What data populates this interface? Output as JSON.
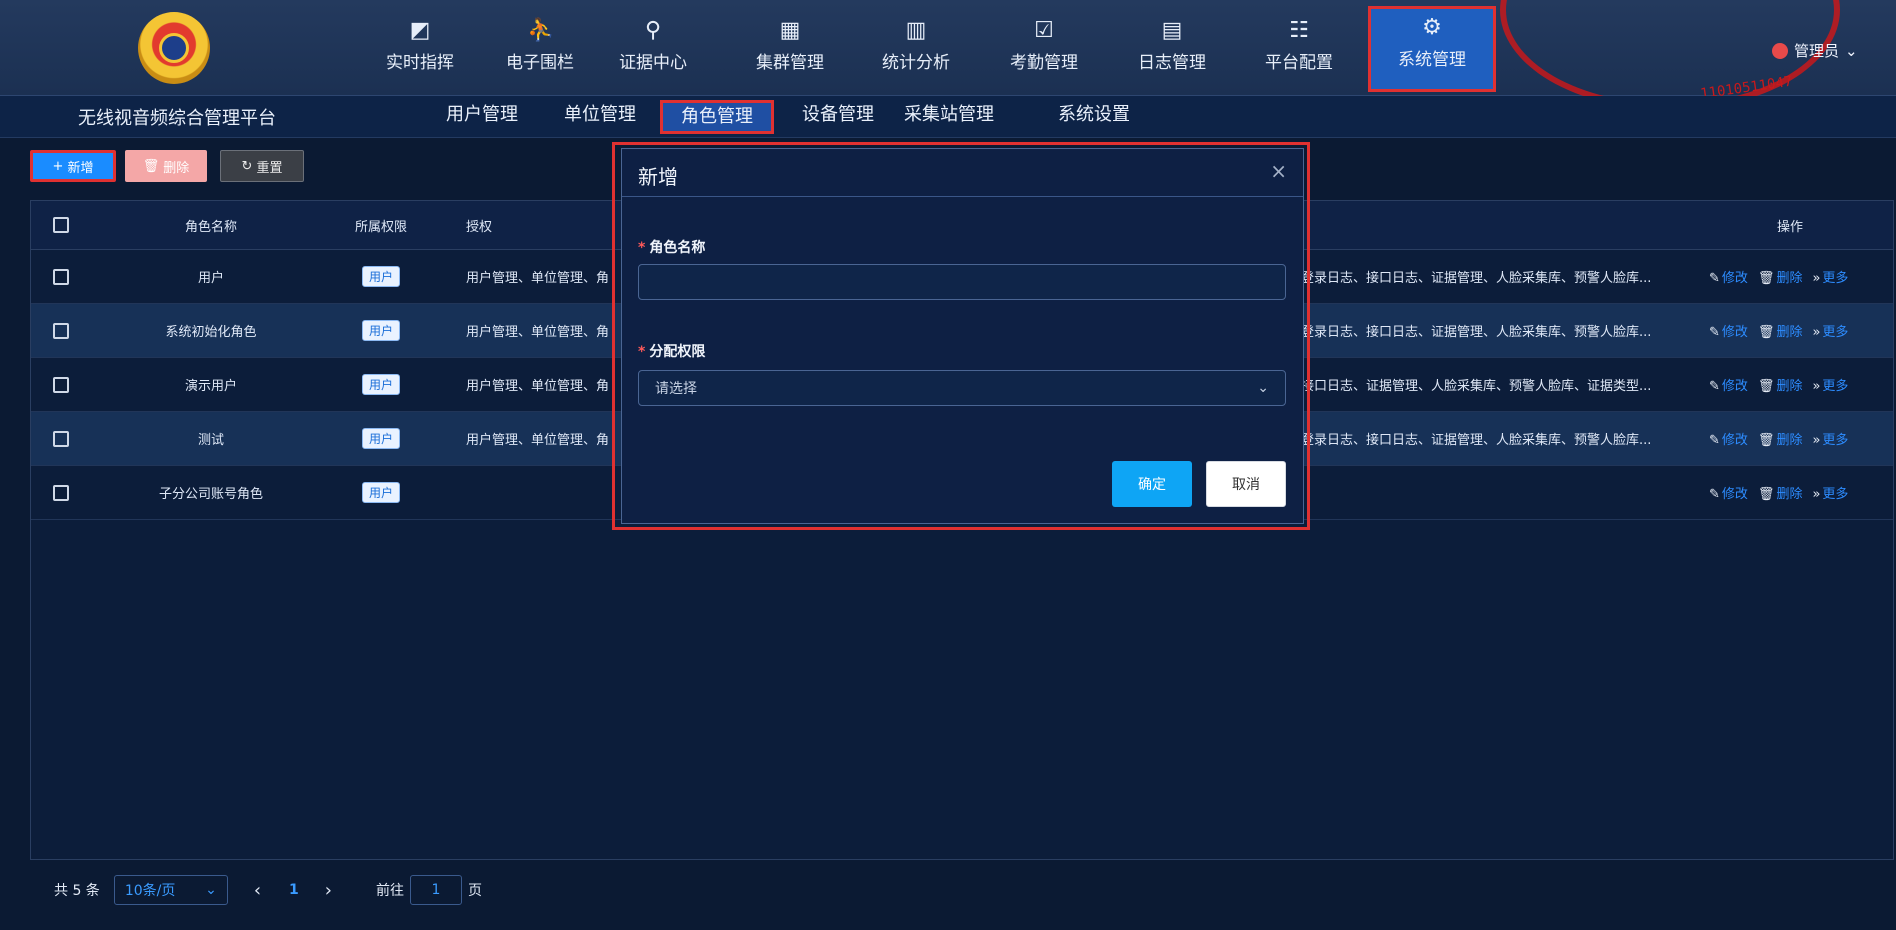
{
  "header": {
    "nav": [
      {
        "label": "实时指挥",
        "icon": "chart-monitor-icon"
      },
      {
        "label": "电子围栏",
        "icon": "fence-runner-icon"
      },
      {
        "label": "证据中心",
        "icon": "evidence-icon"
      },
      {
        "label": "集群管理",
        "icon": "cluster-icon"
      },
      {
        "label": "统计分析",
        "icon": "bar-chart-icon"
      },
      {
        "label": "考勤管理",
        "icon": "calendar-check-icon"
      },
      {
        "label": "日志管理",
        "icon": "log-doc-icon"
      },
      {
        "label": "平台配置",
        "icon": "config-grid-icon"
      },
      {
        "label": "系统管理",
        "icon": "system-settings-icon"
      }
    ],
    "user": "管理员",
    "stamp_text": "11010511047"
  },
  "subnav": {
    "platform_title": "无线视音频综合管理平台",
    "items": [
      "用户管理",
      "单位管理",
      "角色管理",
      "设备管理",
      "采集站管理",
      "系统设置"
    ]
  },
  "toolbar": {
    "add": "新增",
    "delete": "删除",
    "reset": "重置"
  },
  "table": {
    "headers": {
      "name": "角色名称",
      "scope": "所属权限",
      "auth": "授权",
      "ops": "操作"
    },
    "rows": [
      {
        "name": "用户",
        "scope": "用户",
        "auth_left": "用户管理、单位管理、角",
        "auth_right": "登录日志、接口日志、证据管理、人脸采集库、预警人脸库..."
      },
      {
        "name": "系统初始化角色",
        "scope": "用户",
        "auth_left": "用户管理、单位管理、角",
        "auth_right": "登录日志、接口日志、证据管理、人脸采集库、预警人脸库..."
      },
      {
        "name": "演示用户",
        "scope": "用户",
        "auth_left": "用户管理、单位管理、角",
        "auth_right": "接口日志、证据管理、人脸采集库、预警人脸库、证据类型..."
      },
      {
        "name": "测试",
        "scope": "用户",
        "auth_left": "用户管理、单位管理、角",
        "auth_right": "登录日志、接口日志、证据管理、人脸采集库、预警人脸库..."
      },
      {
        "name": "子分公司账号角色",
        "scope": "用户",
        "auth_left": "",
        "auth_right": ""
      }
    ],
    "op_edit": "修改",
    "op_delete": "删除",
    "op_more": "更多"
  },
  "pagination": {
    "total": "共 5 条",
    "page_size": "10条/页",
    "current": "1",
    "goto_label": "前往",
    "goto_value": "1",
    "page_suffix": "页"
  },
  "modal": {
    "title": "新增",
    "close": "×",
    "role_name_label": "角色名称",
    "role_name_value": "",
    "perm_label": "分配权限",
    "perm_placeholder": "请选择",
    "ok": "确定",
    "cancel": "取消"
  },
  "colors": {
    "accent": "#1a8cff",
    "highlight": "#e03131",
    "bg": "#0b1a33"
  }
}
